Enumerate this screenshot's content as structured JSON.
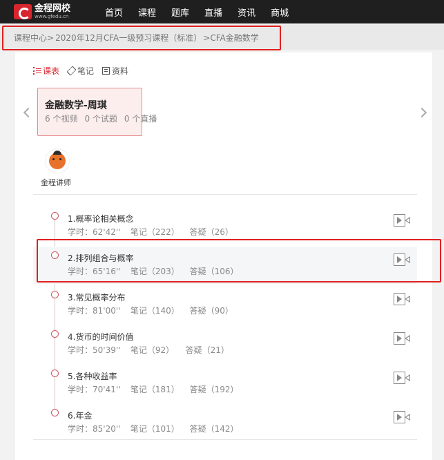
{
  "header": {
    "logo_text": "金程网校",
    "logo_url": "www.gfedu.cn",
    "nav": [
      "首页",
      "课程",
      "题库",
      "直播",
      "资讯",
      "商城"
    ]
  },
  "breadcrumb": [
    "课程中心>",
    "2020年12月CFA一级预习课程（标准）",
    ">CFA金融数学"
  ],
  "tabs": [
    {
      "label": "课表",
      "icon": "list-icon",
      "active": true
    },
    {
      "label": "笔记",
      "icon": "pencil-icon",
      "active": false
    },
    {
      "label": "资料",
      "icon": "document-icon",
      "active": false
    }
  ],
  "course_card": {
    "title": "金融数学-周琪",
    "videos": "6 个视频",
    "exercises": "0 个试题",
    "lives": "0 个直播"
  },
  "teacher_label": "金程讲师",
  "lessons": [
    {
      "title": "1.概率论相关概念",
      "duration": "学时：62'42''",
      "notes": "笔记（222）",
      "qa": "答疑（26）"
    },
    {
      "title": "2.排列组合与概率",
      "duration": "学时：65'16''",
      "notes": "笔记（203）",
      "qa": "答疑（106）"
    },
    {
      "title": "3.常见概率分布",
      "duration": "学时：81'00''",
      "notes": "笔记（140）",
      "qa": "答疑（90）"
    },
    {
      "title": "4.货币的时间价值",
      "duration": "学时：50'39''",
      "notes": "笔记（92）",
      "qa": "答疑（21）"
    },
    {
      "title": "5.各种收益率",
      "duration": "学时：70'41''",
      "notes": "笔记（181）",
      "qa": "答疑（192）"
    },
    {
      "title": "6.年金",
      "duration": "学时：85'20''",
      "notes": "笔记（101）",
      "qa": "答疑（142）"
    }
  ],
  "colors": {
    "accent": "#d8262f",
    "header_bg": "#1f1f1f",
    "highlight_border": "#e02020"
  }
}
